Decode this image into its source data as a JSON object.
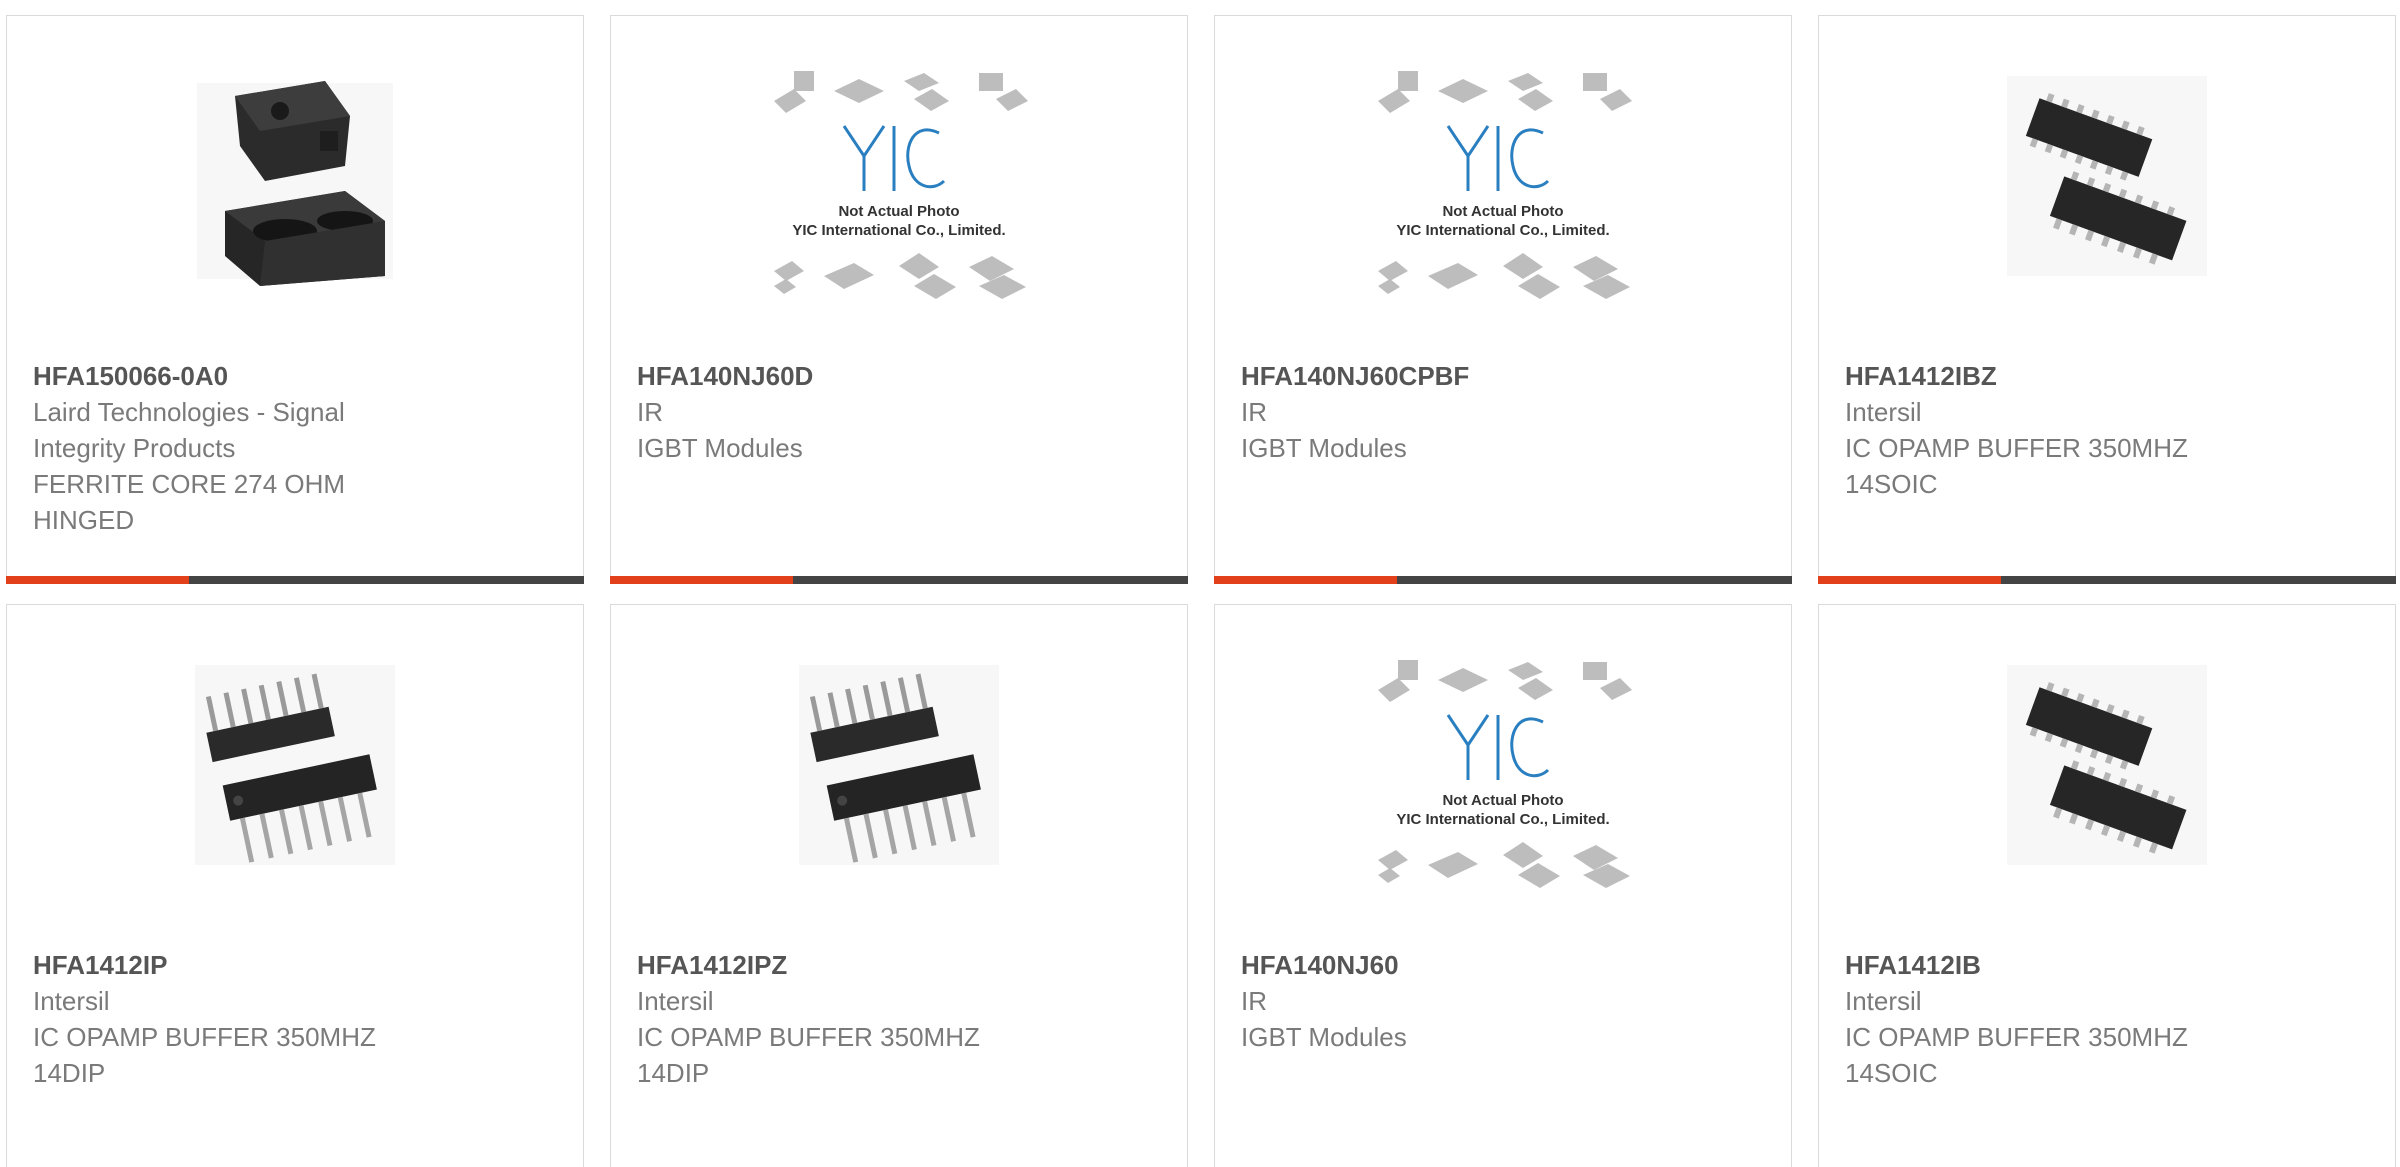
{
  "theme": {
    "accent_color": "#e1401b",
    "bar_color": "#444444",
    "border_color": "#dadada",
    "title_color": "#555555",
    "text_color": "#7a7a7a"
  },
  "placeholder": {
    "line1": "Not Actual Photo",
    "line2": "YIC International Co., Limited.",
    "logo": "YIC"
  },
  "products": [
    {
      "part": "HFA150066-0A0",
      "manufacturer": "Laird Technologies - Signal Integrity Products",
      "description": "FERRITE CORE 274 OHM HINGED",
      "image": "ferrite-core-photo"
    },
    {
      "part": "HFA140NJ60D",
      "manufacturer": "IR",
      "description": "IGBT Modules",
      "image": "not-actual-photo-placeholder"
    },
    {
      "part": "HFA140NJ60CPBF",
      "manufacturer": "IR",
      "description": "IGBT Modules",
      "image": "not-actual-photo-placeholder"
    },
    {
      "part": "HFA1412IBZ",
      "manufacturer": "Intersil",
      "description": "IC OPAMP BUFFER 350MHZ 14SOIC",
      "image": "soic-chip-photo"
    },
    {
      "part": "HFA1412IP",
      "manufacturer": "Intersil",
      "description": "IC OPAMP BUFFER 350MHZ 14DIP",
      "image": "dip-chip-photo"
    },
    {
      "part": "HFA1412IPZ",
      "manufacturer": "Intersil",
      "description": "IC OPAMP BUFFER 350MHZ 14DIP",
      "image": "dip-chip-photo"
    },
    {
      "part": "HFA140NJ60",
      "manufacturer": "IR",
      "description": "IGBT Modules",
      "image": "not-actual-photo-placeholder"
    },
    {
      "part": "HFA1412IB",
      "manufacturer": "Intersil",
      "description": "IC OPAMP BUFFER 350MHZ 14SOIC",
      "image": "soic-chip-photo"
    }
  ]
}
